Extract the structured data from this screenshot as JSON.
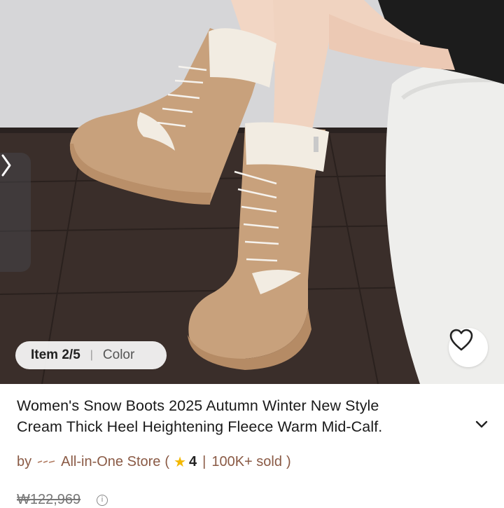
{
  "gallery": {
    "counter": "Item 2/5",
    "separator": "|",
    "color_label": "Color",
    "icons": {
      "next": "chevron-right-icon",
      "favorite": "heart-icon"
    }
  },
  "product": {
    "title_line1": "Women's Snow Boots 2025 Autumn Winter New Style",
    "title_line2": "Cream Thick Heel Heightening Fleece Warm Mid-Calf.",
    "expand_icon": "chevron-down-icon"
  },
  "store": {
    "by": "by",
    "name": "All-in-One Store",
    "open_paren": "(",
    "rating": "4",
    "pipe": "|",
    "sold": "100K+ sold",
    "close_paren": ")"
  },
  "price": {
    "original": "₩122,969",
    "info_icon": "info-icon"
  },
  "colors": {
    "store_text": "#8a5a45",
    "star": "#f3b800",
    "boot_suede": "#c8a17c",
    "fleece": "#f2ece2"
  }
}
